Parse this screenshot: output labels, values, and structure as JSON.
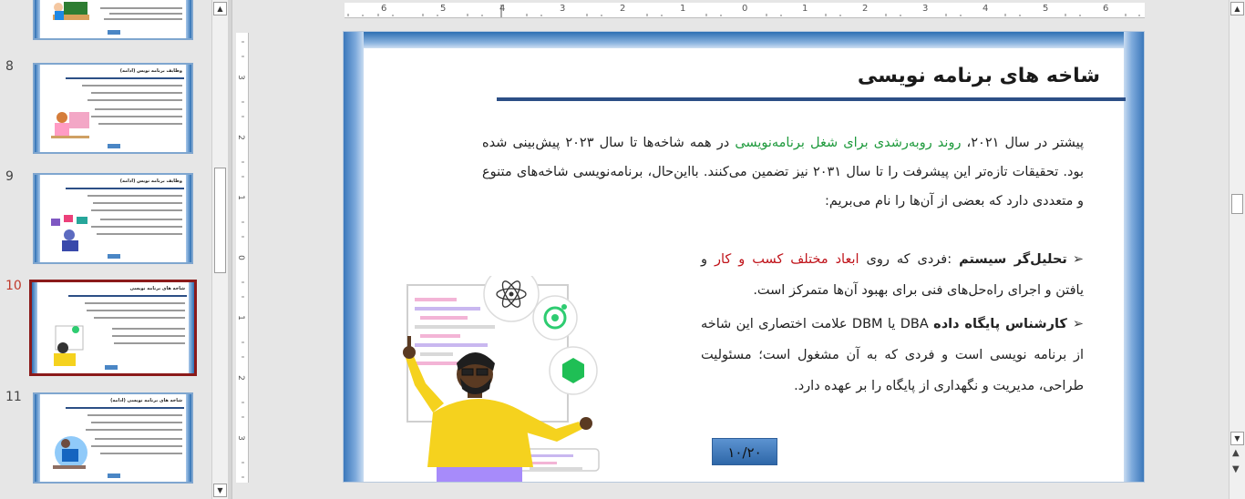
{
  "thumbnails": [
    {
      "number": "",
      "title": ""
    },
    {
      "number": "8",
      "title": "وظایف برنامه نویس (ادامه)"
    },
    {
      "number": "9",
      "title": "وظایف برنامه نویس (ادامه)"
    },
    {
      "number": "10",
      "title": "شاخه های برنامه نویسی"
    },
    {
      "number": "11",
      "title": "شاخه های برنامه نویسی (ادامه)"
    }
  ],
  "ruler": {
    "horizontal_labels": [
      "6",
      "5",
      "4",
      "3",
      "2",
      "1",
      "0",
      "1",
      "2",
      "3",
      "4",
      "5",
      "6"
    ],
    "vertical_labels": [
      "3",
      "2",
      "1",
      "0",
      "1",
      "2",
      "3"
    ]
  },
  "slide": {
    "title": "شاخه های برنامه نویسی",
    "intro_part1": "پیشتر در سال ۲۰۲۱، ",
    "intro_highlight": "روند روبه‌رشدی برای شغل برنامه‌نویسی",
    "intro_part2": " در همه شاخه‌ها تا سال ۲۰۲۳ پیش‌بینی شده بود. تحقیقات تازه‌تر این پیشرفت را تا سال ۲۰۳۱ نیز تضمین می‌کنند. بااین‌حال، برنامه‌نویسی شاخه‌های متنوع و متعددی دارد که بعضی از آن‌ها را نام می‌بریم:",
    "bullet1_bold": "تحلیل‌گر سیستم",
    "bullet1_part1": " :فردی که روی ",
    "bullet1_highlight": "ابعاد مختلف کسب و کار",
    "bullet1_part2": " و یافتن و اجرای راه‌حل‌های فنی برای بهبود آن‌ها متمرکز است.",
    "bullet2_bold": "کارشناس پایگاه داده",
    "bullet2_text": " DBA یا DBM علامت اختصاری این شاخه از برنامه نویسی است و فردی که به آن مشغول است؛ مسئولیت طراحی، مدیریت و نگهداری از پایگاه را بر عهده دارد.",
    "page_number": "۱۰/۲۰"
  },
  "colors": {
    "accent_blue": "#2c6fb3",
    "title_rule": "#2c4f86",
    "highlight_green": "#1f9a3d",
    "highlight_red": "#c0141b",
    "active_thumb_border": "#8b1a1a"
  },
  "icons": {
    "bullet": "arrow-bullet-icon",
    "scroll_up": "triangle-up-icon",
    "scroll_down": "triangle-down-icon",
    "prev_slide": "double-up-icon",
    "next_slide": "double-down-icon"
  }
}
